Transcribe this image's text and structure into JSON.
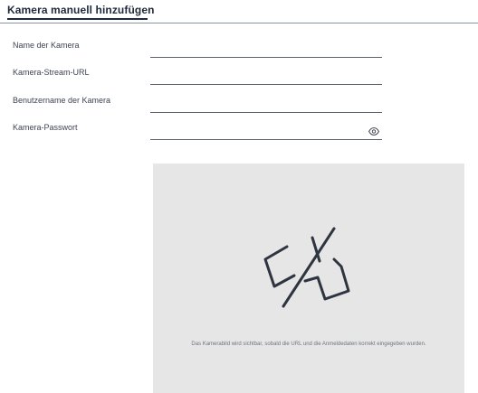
{
  "dialog": {
    "title": "Kamera manuell hinzufügen"
  },
  "fields": [
    {
      "label": "Name der Kamera",
      "value": "",
      "placeholder": ""
    },
    {
      "label": "Kamera-Stream-URL",
      "value": "",
      "placeholder": ""
    },
    {
      "label": "Benutzername der Kamera",
      "value": "",
      "placeholder": ""
    },
    {
      "label": "Kamera-Passwort",
      "value": "",
      "placeholder": ""
    }
  ],
  "password_toggle_icon": "eye-icon",
  "preview": {
    "icon": "camera-off-icon",
    "message": "Das Kamerabild wird sichtbar, sobald die URL und die Anmeldedaten korrekt eingegeben wurden."
  },
  "colors": {
    "text": "#2b3340",
    "title": "#1f2a3a",
    "preview_bg": "#e6e6e6",
    "icon": "#2e3440"
  }
}
